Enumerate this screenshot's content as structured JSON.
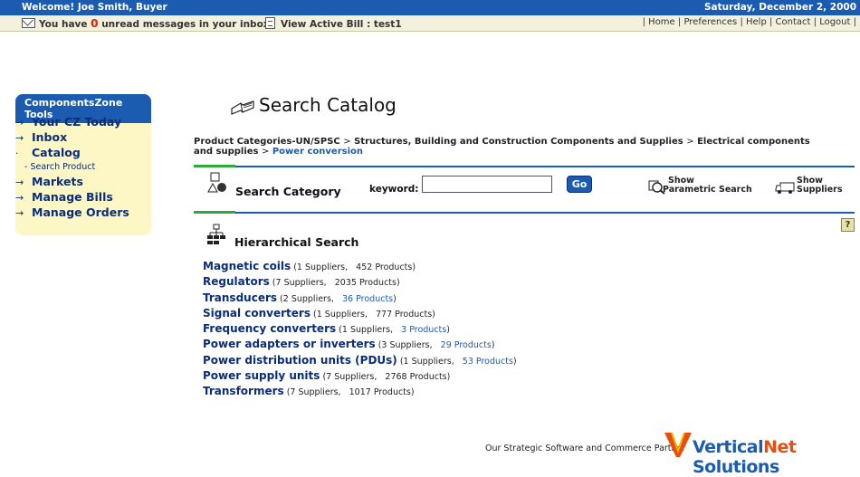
{
  "topbar": {
    "welcome": "Welcome! Joe Smith, Buyer",
    "date": "Saturday, December 2, 2000"
  },
  "subbar": {
    "messages_prefix": "You have",
    "unread_count": "0",
    "messages_suffix": "unread messages in your inbox",
    "active_bill": "View Active Bill : test1",
    "links": [
      "Home",
      "Preferences",
      "Help",
      "Contact",
      "Logout"
    ]
  },
  "sidebar": {
    "title": "ComponentsZone Tools",
    "items": [
      {
        "label": "Your CZ Today"
      },
      {
        "label": "Inbox"
      },
      {
        "label": "Catalog"
      },
      {
        "label": "Markets"
      },
      {
        "label": "Manage Bills"
      },
      {
        "label": "Manage Orders"
      }
    ],
    "catalog_sub": "- Search Product"
  },
  "main": {
    "title": "Search Catalog",
    "breadcrumb": {
      "root": "Product Categories-UN/SPSC",
      "level1": "Structures, Building and Construction Components and Supplies",
      "level2": "Electrical components and supplies",
      "current": "Power conversion",
      "separator": ">"
    },
    "search": {
      "label": "Search Category",
      "keyword_label": "keyword:",
      "keyword_value": "",
      "go_label": "Go",
      "show": "Show",
      "parametric": "Parametric Search",
      "suppliers": "Suppliers"
    },
    "help_label": "?",
    "hier_title": "Hierarchical Search",
    "categories": [
      {
        "name": "Magnetic coils",
        "suppliers": "(1 Suppliers,",
        "products": "452 Products)",
        "products_link": false
      },
      {
        "name": "Regulators",
        "suppliers": "(7 Suppliers,",
        "products": "2035 Products)",
        "products_link": false
      },
      {
        "name": "Transducers",
        "suppliers": "(2 Suppliers,",
        "products": "36 Products",
        "products_link": true
      },
      {
        "name": "Signal converters",
        "suppliers": "(1 Suppliers,",
        "products": "777 Products)",
        "products_link": false
      },
      {
        "name": "Frequency converters",
        "suppliers": "(1 Suppliers,",
        "products": "3 Products",
        "products_link": true
      },
      {
        "name": "Power adapters or inverters",
        "suppliers": "(3 Suppliers,",
        "products": "29 Products",
        "products_link": true
      },
      {
        "name": "Power distribution units (PDUs)",
        "suppliers": "(1 Suppliers,",
        "products": "53 Products",
        "products_link": true
      },
      {
        "name": "Power supply units",
        "suppliers": "(7 Suppliers,",
        "products": "2768 Products)",
        "products_link": false
      },
      {
        "name": "Transformers",
        "suppliers": "(7 Suppliers,",
        "products": "1017 Products)",
        "products_link": false
      }
    ]
  },
  "footer": {
    "partner_text": "Our Strategic Software and Commerce Partner",
    "brand_part1": "Vertical",
    "brand_part2": "Net",
    "brand_part3": " Solutions"
  },
  "colors": {
    "brand_blue": "#1b5bb0",
    "nav_navy": "#0a2d7a",
    "sidebar_bg": "#fdf7c5",
    "accent_green": "#2fa83a",
    "alert_red": "#e02000"
  }
}
